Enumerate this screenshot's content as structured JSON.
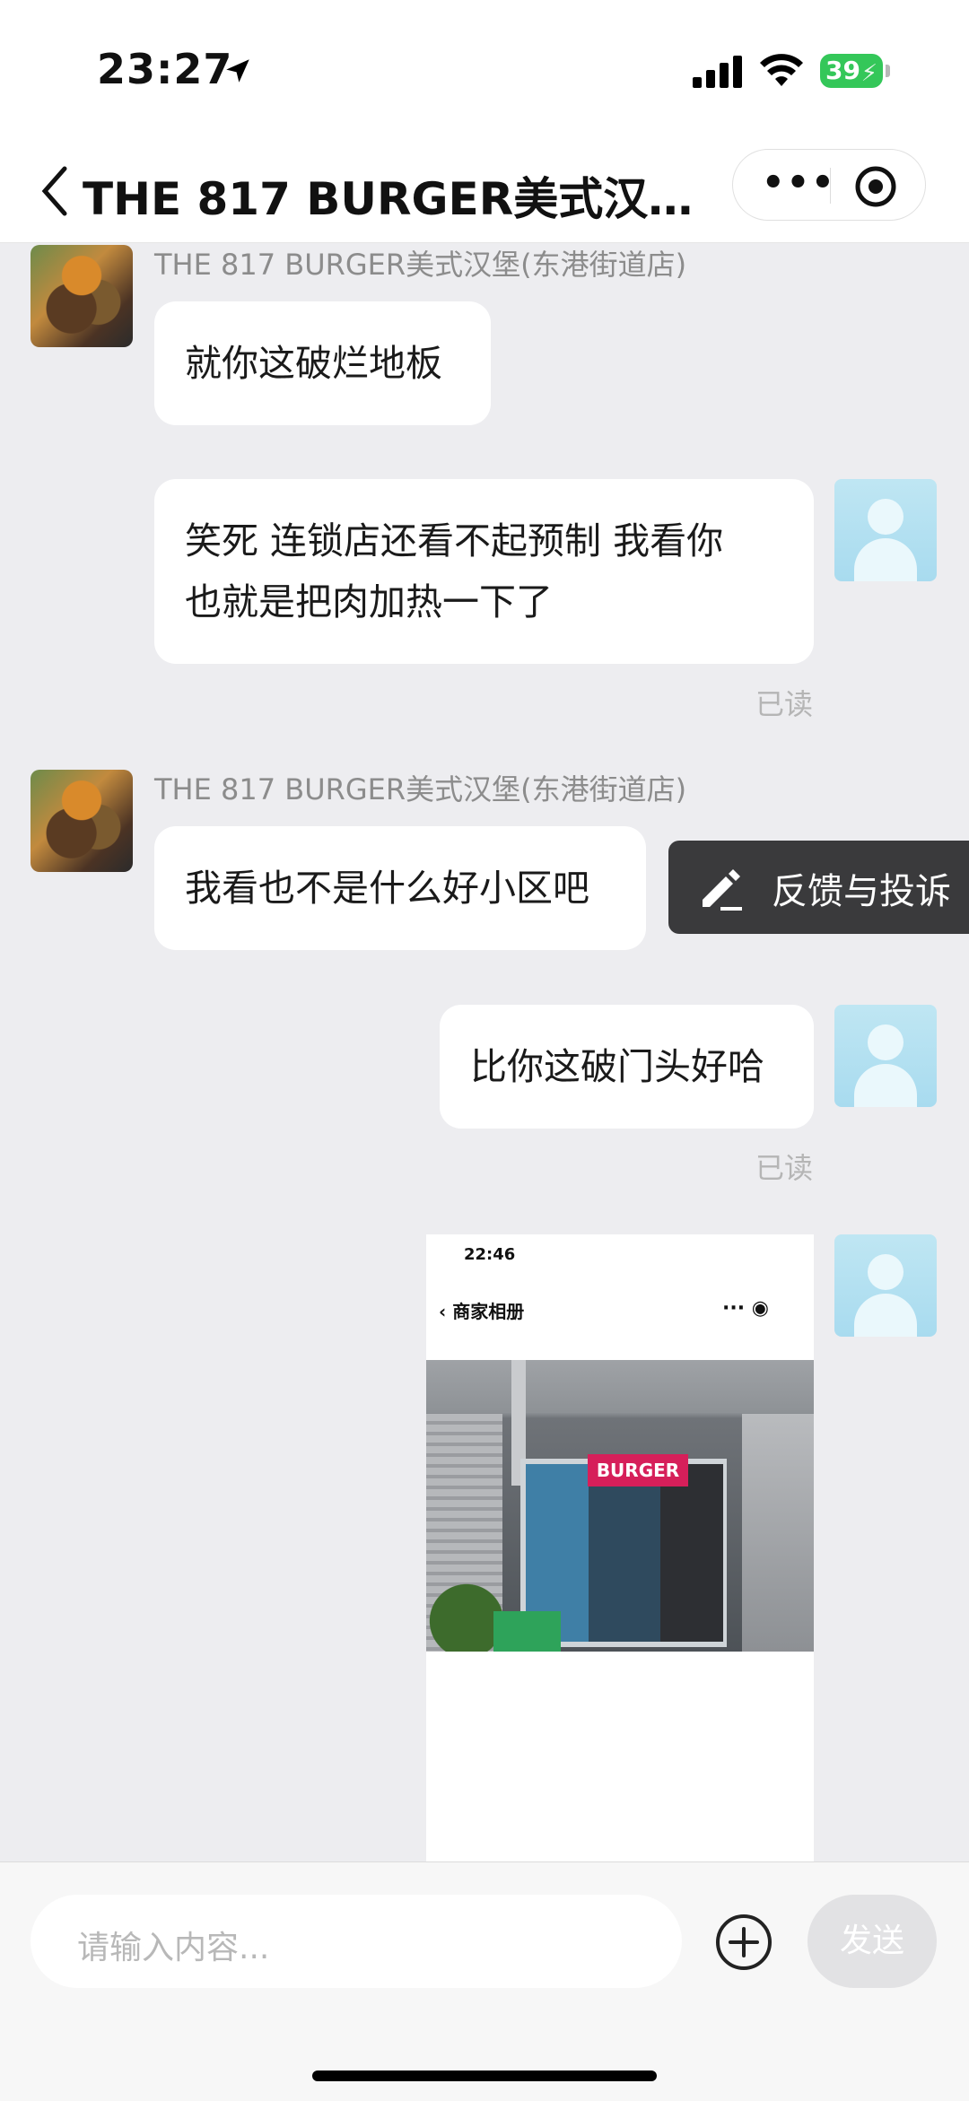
{
  "status": {
    "time": "23:27",
    "battery": "39"
  },
  "header": {
    "title": "THE 817 BURGER美式汉…"
  },
  "messages": [
    {
      "sender": "THE 817 BURGER美式汉堡(东港街道店)",
      "text": "就你这破烂地板"
    },
    {
      "line1": "笑死 连锁店还看不起预制 我看你",
      "line2": "也就是把肉加热一下了",
      "read": "已读"
    },
    {
      "sender": "THE 817 BURGER美式汉堡(东港街道店)",
      "text": "我看也不是什么好小区吧"
    },
    {
      "text": "比你这破门头好哈",
      "read": "已读"
    }
  ],
  "feedback": {
    "label": "反馈与投诉"
  },
  "image_message": {
    "time": "22:46",
    "title": "商家相册",
    "sign": "BURGER"
  },
  "input": {
    "placeholder": "请输入内容...",
    "send": "发送"
  }
}
